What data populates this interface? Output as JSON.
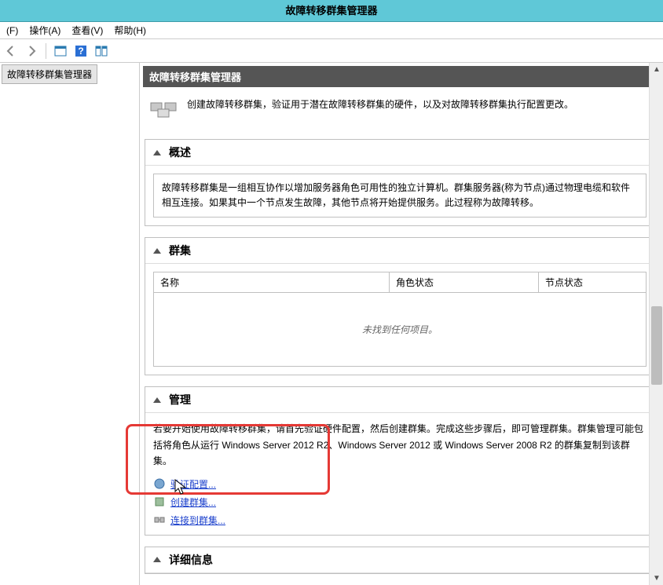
{
  "window": {
    "title": "故障转移群集管理器"
  },
  "menu": {
    "file": "(F)",
    "action": "操作(A)",
    "view": "查看(V)",
    "help": "帮助(H)"
  },
  "tree": {
    "root": "故障转移群集管理器"
  },
  "header": {
    "title": "故障转移群集管理器"
  },
  "intro": {
    "text": "创建故障转移群集，验证用于潜在故障转移群集的硬件，以及对故障转移群集执行配置更改。"
  },
  "sections": {
    "overview": {
      "title": "概述",
      "body": "故障转移群集是一组相互协作以增加服务器角色可用性的独立计算机。群集服务器(称为节点)通过物理电缆和软件相互连接。如果其中一个节点发生故障，其他节点将开始提供服务。此过程称为故障转移。"
    },
    "clusters": {
      "title": "群集",
      "columns": {
        "name": "名称",
        "role": "角色状态",
        "node": "节点状态"
      },
      "empty": "未找到任何项目。"
    },
    "management": {
      "title": "管理",
      "body": "若要开始使用故障转移群集，请首先验证硬件配置，然后创建群集。完成这些步骤后，即可管理群集。群集管理可能包括将角色从运行 Windows Server 2012 R2、Windows Server 2012 或 Windows Server 2008 R2 的群集复制到该群集。",
      "links": {
        "validate": "验证配置...",
        "create": "创建群集...",
        "connect": "连接到群集..."
      }
    },
    "details": {
      "title": "详细信息"
    }
  }
}
